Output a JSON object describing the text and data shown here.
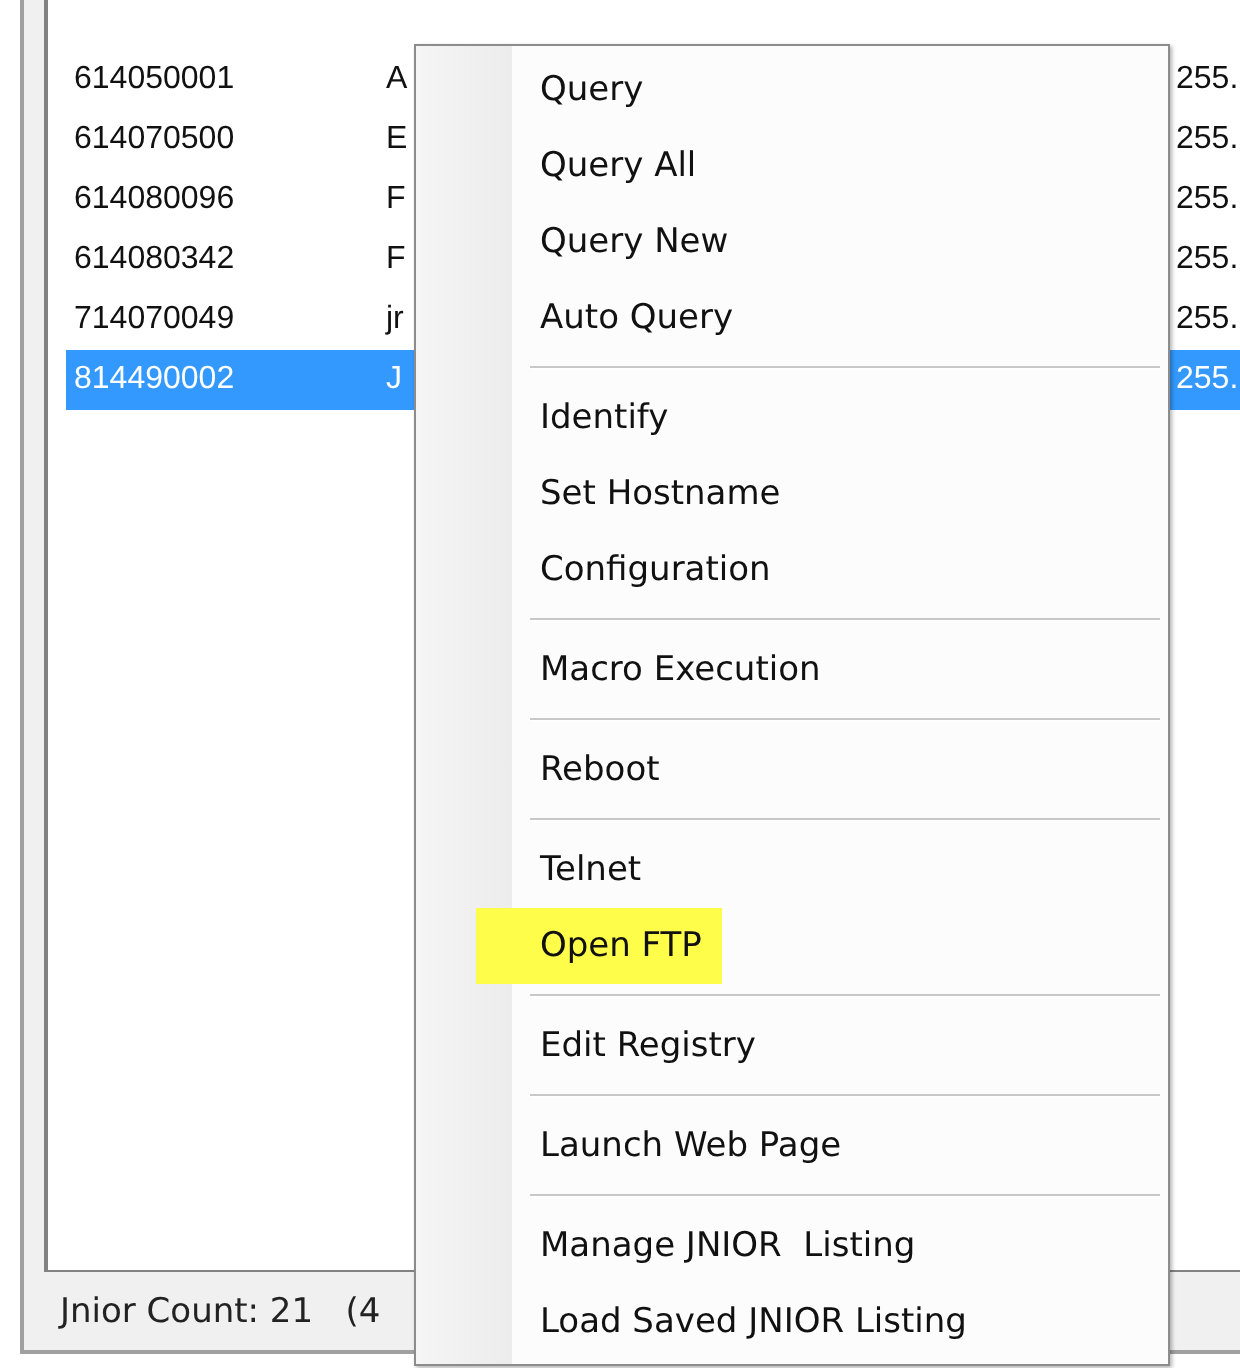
{
  "list": {
    "rows": [
      {
        "serial": "614050001",
        "name": "A",
        "ip": "",
        "mask": "255.",
        "selected": false
      },
      {
        "serial": "614070500",
        "name": "E",
        "ip": "",
        "mask": "255.",
        "selected": false
      },
      {
        "serial": "614080096",
        "name": "F",
        "ip": "",
        "mask": "255.",
        "selected": false
      },
      {
        "serial": "614080342",
        "name": "F",
        "ip": "",
        "mask": "255.",
        "selected": false
      },
      {
        "serial": "714070049",
        "name": "jr",
        "ip": "",
        "mask": "255.",
        "selected": false
      },
      {
        "serial": "814490002",
        "name": "J",
        "ip": "",
        "mask": "255.",
        "selected": true
      }
    ]
  },
  "status_bar": {
    "text": "Jnior Count: 21   (4"
  },
  "context_menu": {
    "groups": [
      [
        {
          "label": "Query",
          "highlighted": false
        },
        {
          "label": "Query All",
          "highlighted": false
        },
        {
          "label": "Query New",
          "highlighted": false
        },
        {
          "label": "Auto Query",
          "highlighted": false
        }
      ],
      [
        {
          "label": "Identify",
          "highlighted": false
        },
        {
          "label": "Set Hostname",
          "highlighted": false
        },
        {
          "label": "Configuration",
          "highlighted": false
        }
      ],
      [
        {
          "label": "Macro Execution",
          "highlighted": false
        }
      ],
      [
        {
          "label": "Reboot",
          "highlighted": false
        }
      ],
      [
        {
          "label": "Telnet",
          "highlighted": false
        },
        {
          "label": "Open FTP",
          "highlighted": true
        }
      ],
      [
        {
          "label": "Edit Registry",
          "highlighted": false
        }
      ],
      [
        {
          "label": "Launch Web Page",
          "highlighted": false
        }
      ],
      [
        {
          "label": "Manage JNIOR  Listing",
          "highlighted": false
        },
        {
          "label": "Load Saved JNIOR Listing",
          "highlighted": false
        }
      ]
    ]
  }
}
